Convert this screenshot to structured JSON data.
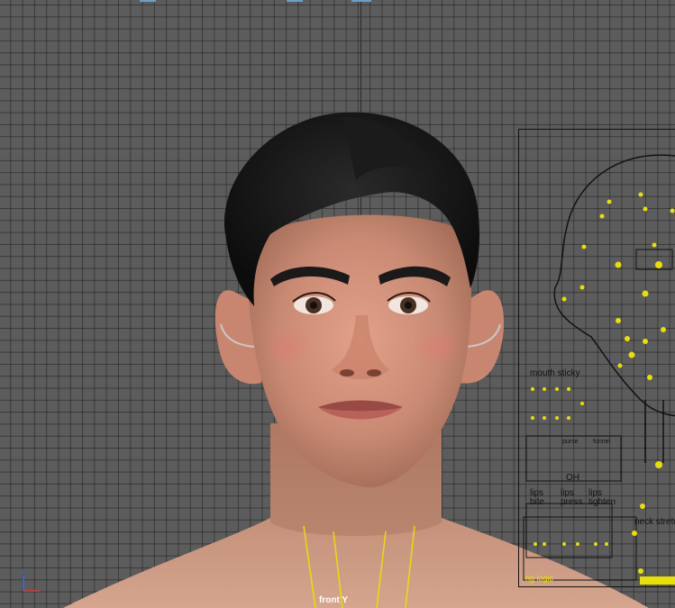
{
  "viewport": {
    "view_label": "front Y",
    "axis_label": "z"
  },
  "face_panel": {
    "mouth_sticky_label": "mouth sticky",
    "funnel_labels": [
      "",
      "purse",
      "funnel"
    ],
    "oh_label": "OH",
    "lips_bite_label_1": "lips",
    "lips_bite_label_2": "bite",
    "lips_press_label_1": "lips",
    "lips_press_label_2": "press",
    "lips_tighten_label_1": "lips",
    "lips_tighten_label_2": "tighten",
    "neck_stretch_label": "neck stretc",
    "rig_logic_label": "rig logic"
  },
  "colors": {
    "viewport_bg": "#5c5c5c",
    "grid": "#2a2a2a",
    "control_yellow": "#e8e000",
    "view_label": "#ffffff"
  }
}
